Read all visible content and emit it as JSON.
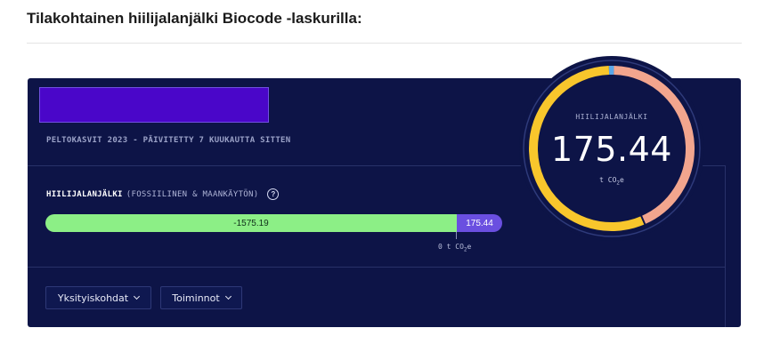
{
  "heading": "Tilakohtainen hiilijalanjälki Biocode -laskurilla:",
  "card": {
    "subtitle": "PELTOKASVIT 2023 - PÄIVITETTY 7 KUUKAUTTA SITTEN",
    "section_label_strong": "HIILIJALANJÄLKI",
    "section_label_light": "(FOSSIILINEN & MAANKÄYTÖN)",
    "help_icon": "question-circle-icon",
    "bar": {
      "negative_value": -1575.19,
      "negative_label": "-1575.19",
      "positive_value": 175.44,
      "positive_label": "175.44",
      "negative_color": "#8cef86",
      "positive_color": "#6a4fe0"
    },
    "zero_label_prefix": "0 t CO",
    "zero_label_sub": "2",
    "zero_label_suffix": "e"
  },
  "buttons": {
    "details_label": "Yksityiskohdat",
    "actions_label": "Toiminnot"
  },
  "gauge": {
    "title": "HIILIJALANJÄLKI",
    "value": "175.44",
    "unit_prefix": "t CO",
    "unit_sub": "2",
    "unit_suffix": "e",
    "segments": [
      {
        "name": "yellow",
        "color": "#f8c62c",
        "fraction": 0.56
      },
      {
        "name": "salmon",
        "color": "#f2a58e",
        "fraction": 0.43
      },
      {
        "name": "blue",
        "color": "#5aa6e8",
        "fraction": 0.01
      }
    ]
  },
  "colors": {
    "card_background": "#0d1447",
    "name_box": "#4a06c9"
  }
}
